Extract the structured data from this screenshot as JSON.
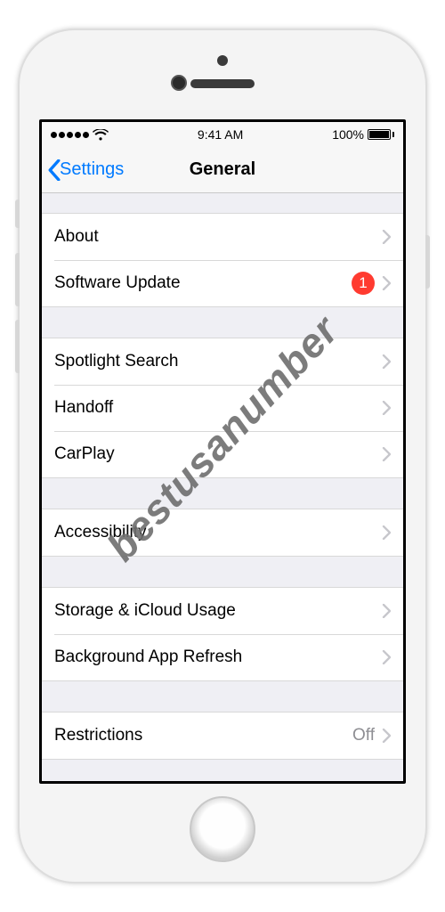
{
  "statusbar": {
    "time": "9:41 AM",
    "battery": "100%"
  },
  "navbar": {
    "back": "Settings",
    "title": "General"
  },
  "groups": [
    [
      {
        "label": "About"
      },
      {
        "label": "Software Update",
        "badge": "1"
      }
    ],
    [
      {
        "label": "Spotlight Search"
      },
      {
        "label": "Handoff"
      },
      {
        "label": "CarPlay"
      }
    ],
    [
      {
        "label": "Accessibility"
      }
    ],
    [
      {
        "label": "Storage & iCloud Usage"
      },
      {
        "label": "Background App Refresh"
      }
    ],
    [
      {
        "label": "Restrictions",
        "detail": "Off"
      }
    ]
  ],
  "watermark": "bestusanumber"
}
